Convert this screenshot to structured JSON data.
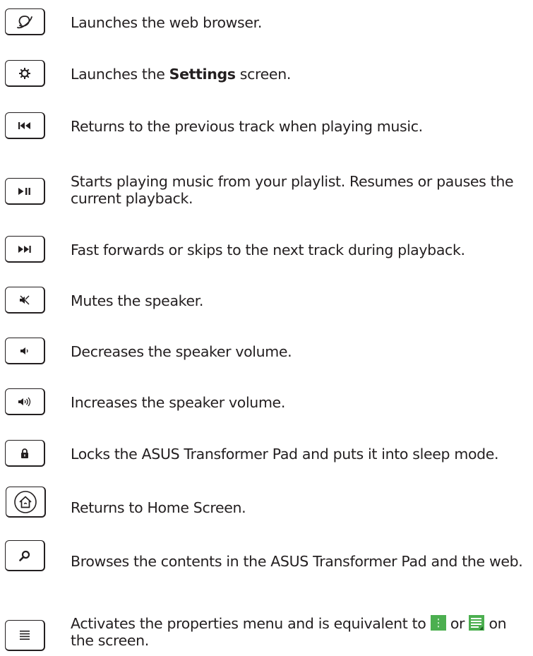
{
  "items": [
    {
      "icon": "globe-icon",
      "text": "Launches the web browser."
    },
    {
      "icon": "gear-icon",
      "text_before": "Launches the ",
      "text_bold": "Settings",
      "text_after": " screen."
    },
    {
      "icon": "previous-track-icon",
      "text": "Returns to the previous track when playing music."
    },
    {
      "icon": "play-pause-icon",
      "text": "Starts playing music from your playlist. Resumes or pauses the current playback."
    },
    {
      "icon": "next-track-icon",
      "text": "Fast forwards or skips to the next track during playback."
    },
    {
      "icon": "mute-icon",
      "text": "Mutes the speaker."
    },
    {
      "icon": "volume-down-icon",
      "text": "Decreases the speaker volume."
    },
    {
      "icon": "volume-up-icon",
      "text": "Increases the speaker volume."
    },
    {
      "icon": "lock-icon",
      "text": "Locks the ASUS Transformer Pad and puts it into sleep mode."
    },
    {
      "icon": "home-icon",
      "text": "Returns to Home Screen."
    },
    {
      "icon": "search-icon",
      "text": "Browses the contents in the ASUS Transformer Pad and the web."
    },
    {
      "icon": "menu-icon",
      "text_before": "Activates the properties menu and is equivalent to ",
      "text_mid": " or ",
      "text_after": " on the screen."
    }
  ],
  "colors": {
    "ink": "#231f20",
    "menu_icon_green": "#4caf50"
  }
}
